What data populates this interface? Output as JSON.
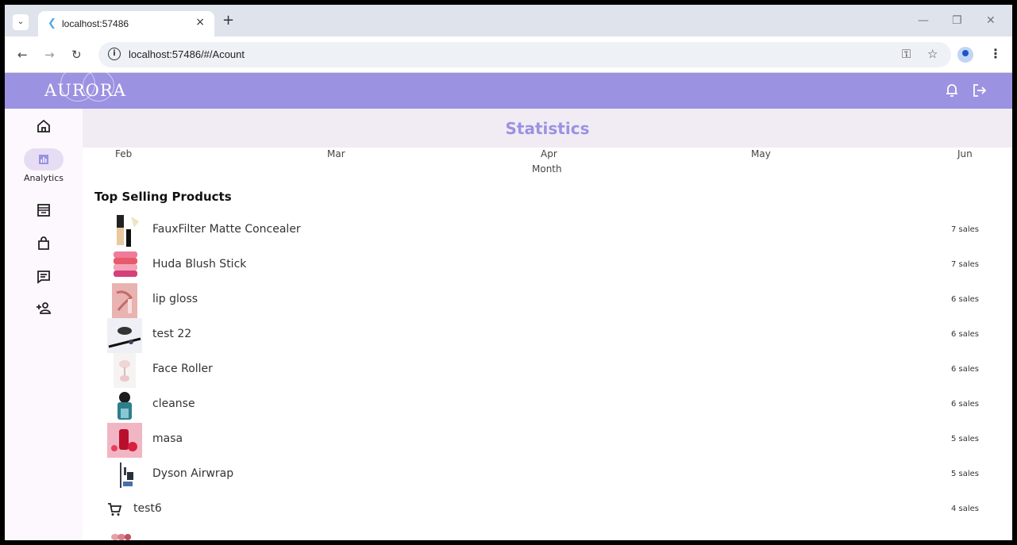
{
  "browser": {
    "tab_title": "localhost:57486",
    "url": "localhost:57486/#/Acount",
    "new_tab": "+",
    "tab_close": "×",
    "minimize": "—",
    "restore": "❐",
    "close": "✕"
  },
  "app": {
    "logo": "AURORA"
  },
  "sidebar": {
    "active_label": "Analytics"
  },
  "page": {
    "title": "Statistics"
  },
  "chart_axis": {
    "months": [
      "Feb",
      "Mar",
      "Apr",
      "May",
      "Jun"
    ],
    "xlabel": "Month"
  },
  "top_selling": {
    "title": "Top Selling Products",
    "products": [
      {
        "name": "FauxFilter Matte Concealer",
        "sales": "7 sales"
      },
      {
        "name": "Huda Blush Stick",
        "sales": "7 sales"
      },
      {
        "name": "lip gloss",
        "sales": "6 sales"
      },
      {
        "name": "test 22",
        "sales": "6 sales"
      },
      {
        "name": "Face Roller",
        "sales": "6 sales"
      },
      {
        "name": "cleanse",
        "sales": "6 sales"
      },
      {
        "name": "masa",
        "sales": "5 sales"
      },
      {
        "name": "Dyson Airwrap",
        "sales": "5 sales"
      },
      {
        "name": "test6",
        "sales": "4 sales"
      }
    ]
  }
}
